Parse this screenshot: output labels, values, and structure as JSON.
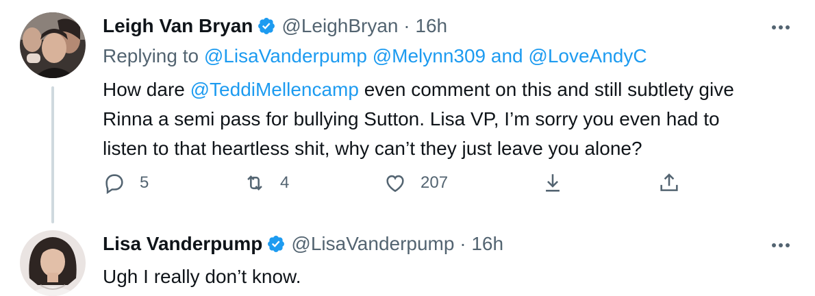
{
  "tweets": [
    {
      "author_name": "Leigh Van Bryan",
      "handle": "@LeighBryan",
      "separator": "·",
      "time": "16h",
      "replying_prefix": "Replying to",
      "replying_mentions_1": "@LisaVanderpump",
      "replying_mentions_2": "@Melynn309",
      "replying_and": "and",
      "replying_mentions_3": "@LoveAndyC",
      "text_line1_prefix": "How dare ",
      "text_mention": "@TeddiMellencamp",
      "text_line1_suffix": " even comment on this and still subtlety give",
      "text_line2": "Rinna a semi pass for bullying Sutton. Lisa VP, I’m sorry you even had to",
      "text_line3": "listen to that heartless shit, why can’t they just leave you alone?",
      "replies": "5",
      "retweets": "4",
      "likes": "207"
    },
    {
      "author_name": "Lisa Vanderpump",
      "handle": "@LisaVanderpump",
      "separator": "·",
      "time": "16h",
      "text": "Ugh I really don’t know."
    }
  ],
  "colors": {
    "verified_blue": "#1d9bf0",
    "mention_blue": "#1d9bf0",
    "secondary_gray": "#536471",
    "thread_line": "#cfd9de"
  },
  "icons": [
    "verified-badge-icon",
    "more-options-icon",
    "reply-icon",
    "retweet-icon",
    "like-icon",
    "download-icon",
    "share-icon"
  ]
}
